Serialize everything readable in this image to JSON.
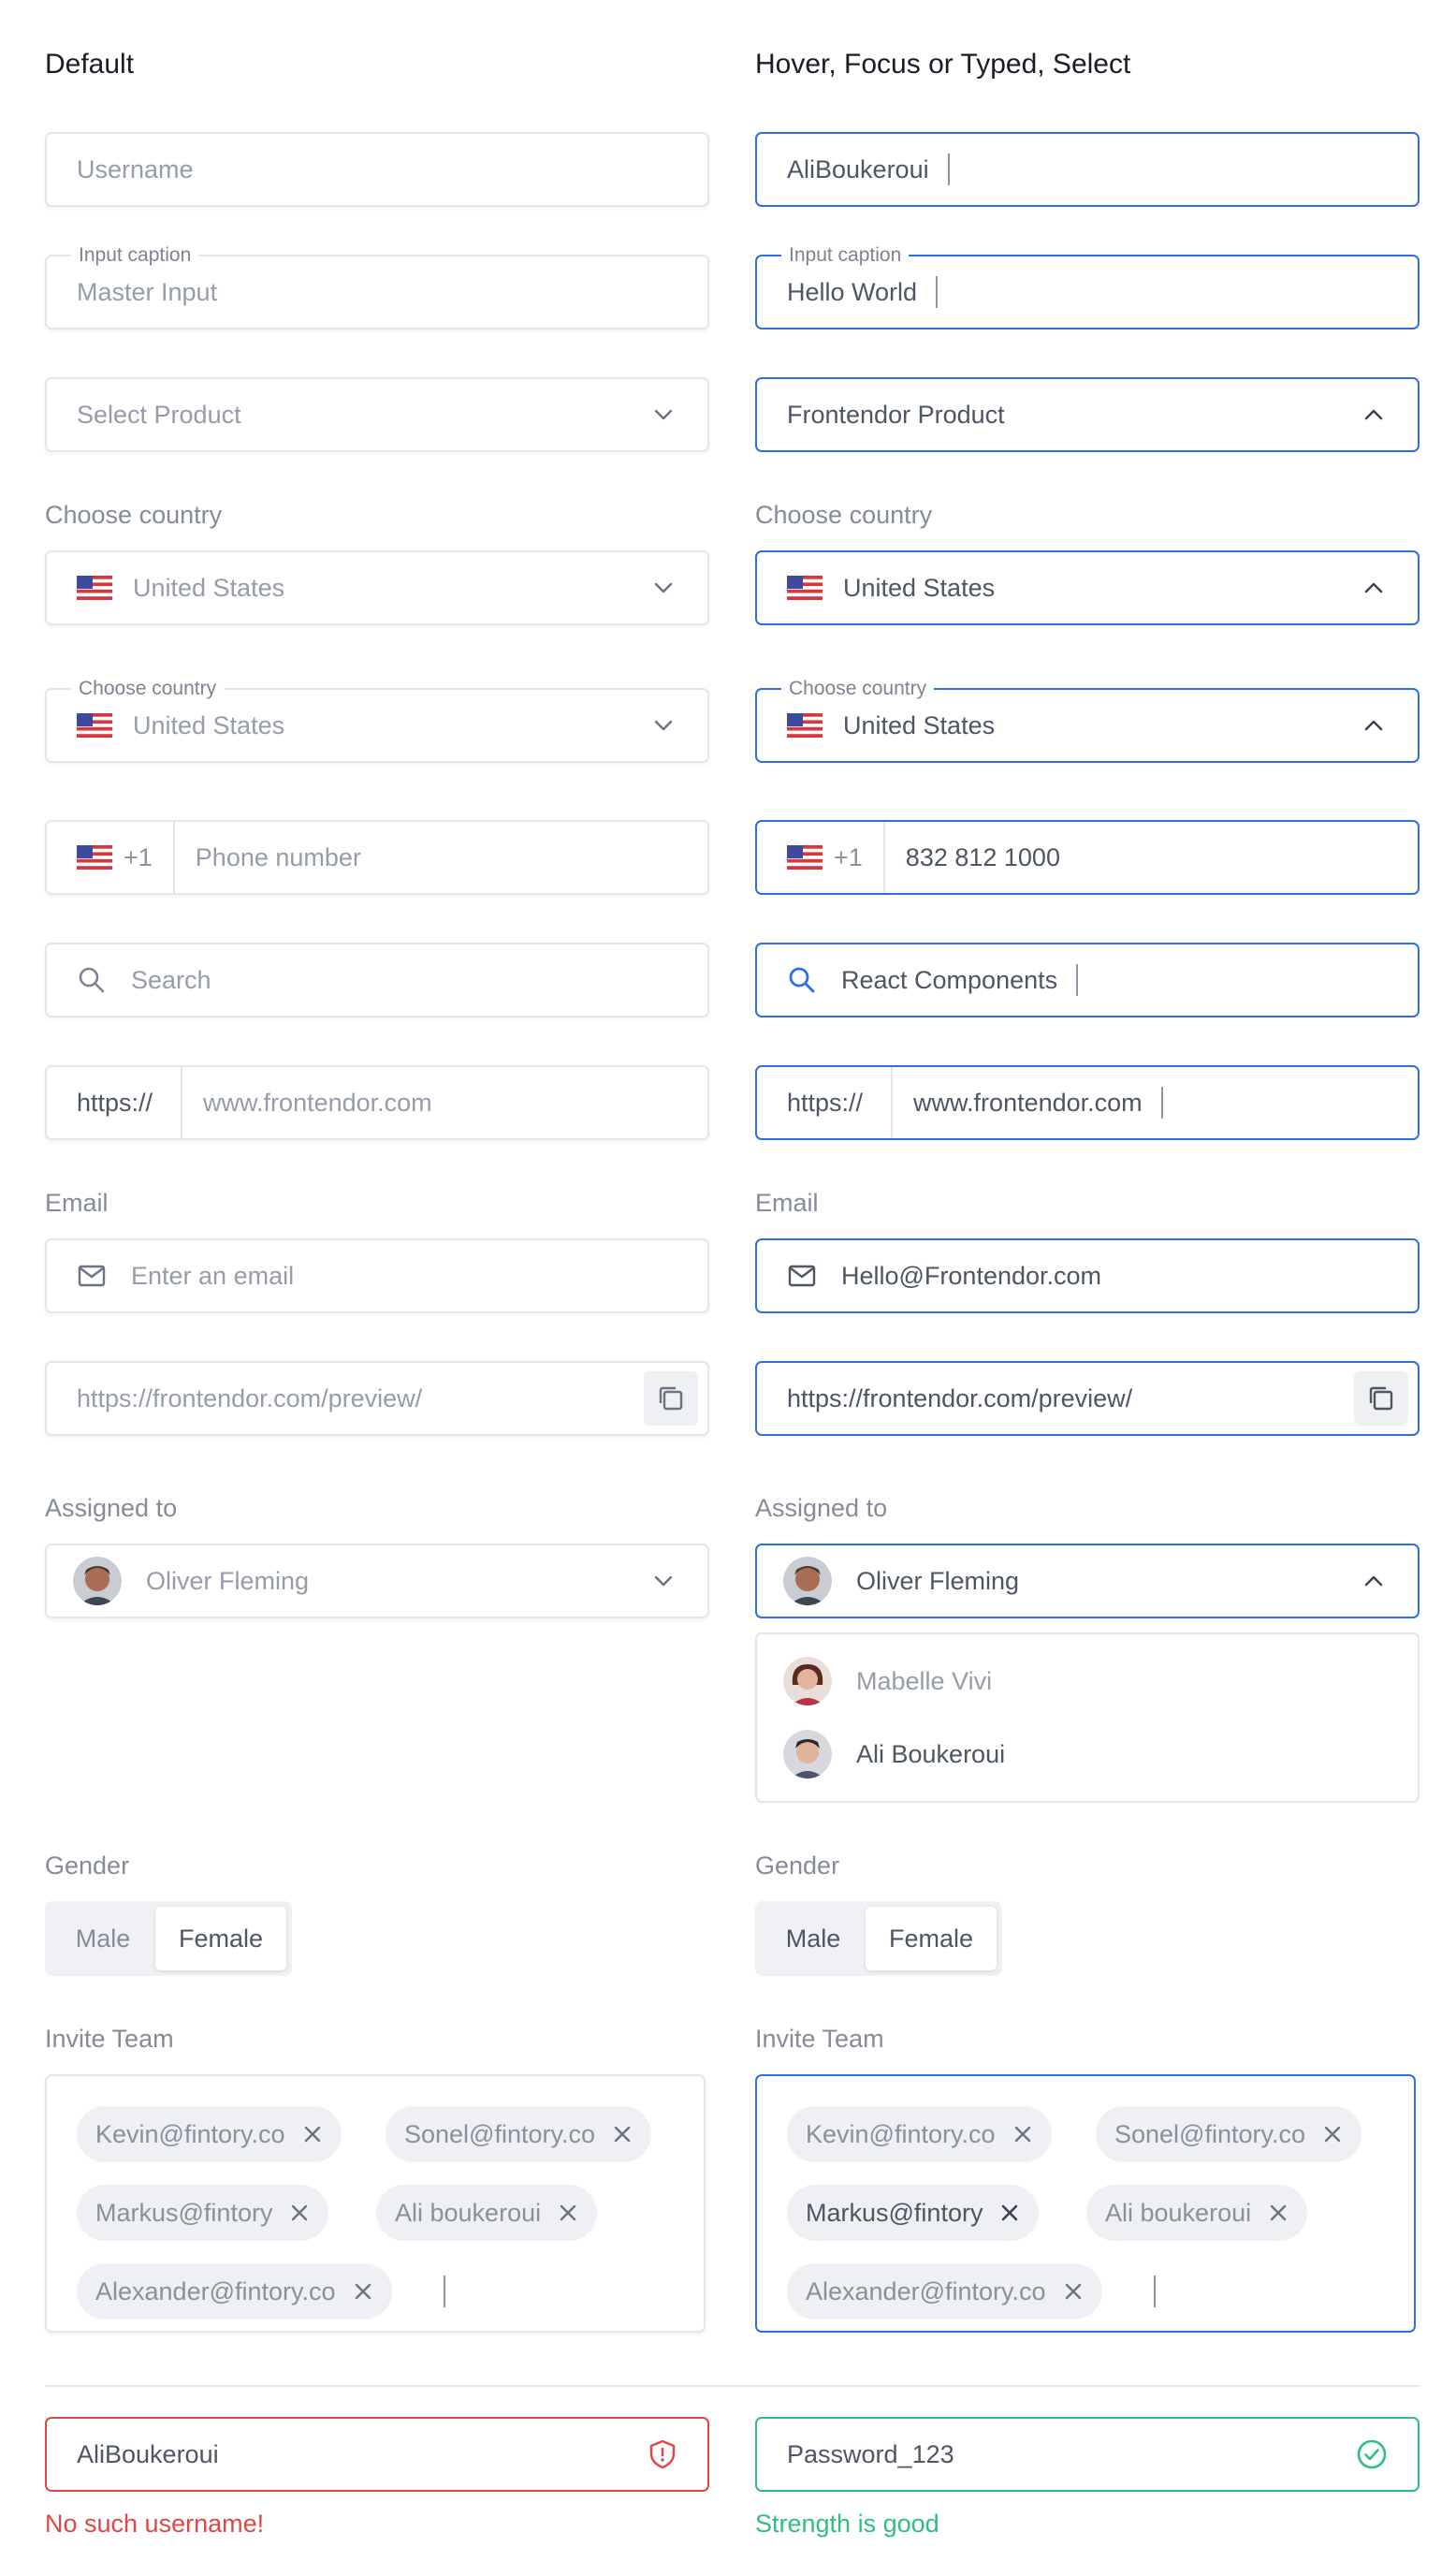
{
  "left": {
    "heading": "Default",
    "username_placeholder": "Username",
    "master": {
      "caption": "Input caption",
      "placeholder": "Master Input"
    },
    "product_placeholder": "Select Product",
    "country_label": "Choose country",
    "country_value": "United States",
    "country_caption": "Choose country",
    "country2_value": "United States",
    "phone": {
      "code": "+1",
      "placeholder": "Phone number"
    },
    "search_placeholder": "Search",
    "url": {
      "prefix": "https://",
      "placeholder": "www.frontendor.com"
    },
    "email_label": "Email",
    "email_placeholder": "Enter an email",
    "preview_url": "https://frontendor.com/preview/",
    "assigned_label": "Assigned to",
    "assigned_value": "Oliver Fleming",
    "gender_label": "Gender",
    "gender_options": [
      "Male",
      "Female"
    ],
    "invite_label": "Invite Team",
    "chips": [
      "Kevin@fintory.co",
      "Sonel@fintory.co",
      "Markus@fintory",
      "Ali boukeroui",
      "Alexander@fintory.co"
    ],
    "error_value": "AliBoukeroui",
    "error_msg": "No such username!"
  },
  "right": {
    "heading": "Hover, Focus or Typed, Select",
    "username_value": "AliBoukeroui",
    "master": {
      "caption": "Input caption",
      "value": "Hello World"
    },
    "product_value": "Frontendor Product",
    "country_label": "Choose country",
    "country_value": "United States",
    "country_caption": "Choose country",
    "country2_value": "United States",
    "phone": {
      "code": "+1",
      "value": "832 812 1000"
    },
    "search_value": "React Components",
    "url": {
      "prefix": "https://",
      "value": "www.frontendor.com"
    },
    "email_label": "Email",
    "email_value": "Hello@Frontendor.com",
    "preview_url": "https://frontendor.com/preview/",
    "assigned_label": "Assigned to",
    "assigned_value": "Oliver Fleming",
    "assigned_options": [
      "Mabelle Vivi",
      "Ali Boukeroui"
    ],
    "gender_label": "Gender",
    "gender_options": [
      "Male",
      "Female"
    ],
    "invite_label": "Invite Team",
    "chips": [
      "Kevin@fintory.co",
      "Sonel@fintory.co",
      "Markus@fintory",
      "Ali boukeroui",
      "Alexander@fintory.co"
    ],
    "success_value": "Password_123",
    "success_msg": "Strength is good"
  },
  "colors": {
    "focus": "#2f6fe3",
    "error": "#e04646",
    "success": "#2ebf7e",
    "border": "#e3e6eb"
  },
  "icons": [
    "us-flag-icon",
    "chevron-down-icon",
    "chevron-up-icon",
    "search-icon",
    "mail-icon",
    "copy-icon",
    "close-icon",
    "shield-alert-icon",
    "check-circle-icon"
  ]
}
